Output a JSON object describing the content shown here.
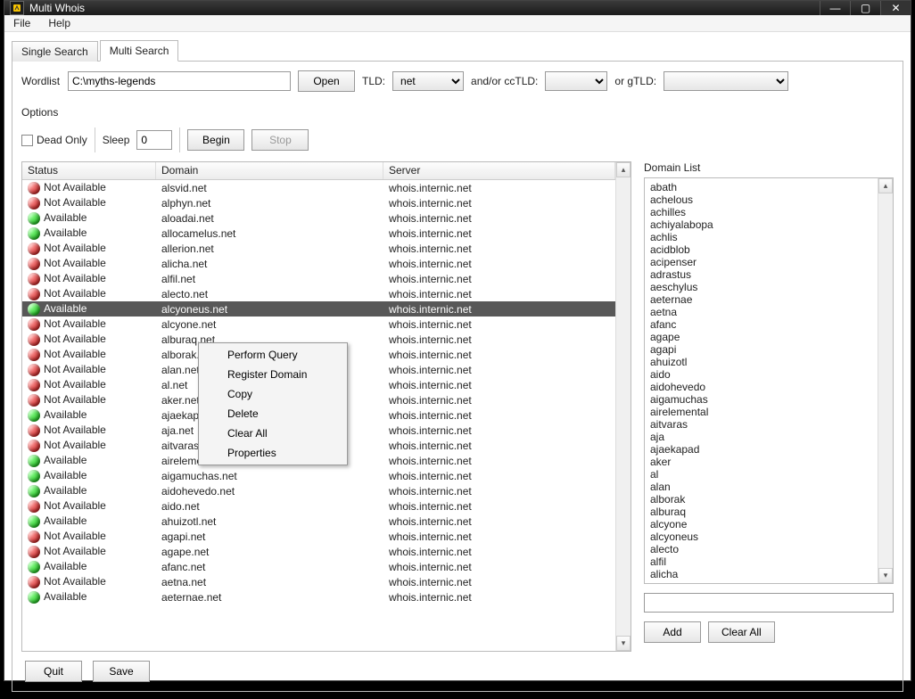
{
  "window": {
    "title": "Multi Whois"
  },
  "menu": {
    "file": "File",
    "help": "Help"
  },
  "tabs": {
    "single": "Single Search",
    "multi": "Multi Search"
  },
  "toolbar": {
    "wordlist_label": "Wordlist",
    "wordlist_value": "C:\\myths-legends",
    "open": "Open",
    "tld_label": "TLD:",
    "tld_value": "net",
    "cctld_label": "and/or ccTLD:",
    "gtld_label": "or gTLD:"
  },
  "options": {
    "heading": "Options",
    "dead_only": "Dead Only",
    "sleep_label": "Sleep",
    "sleep_value": "0",
    "begin": "Begin",
    "stop": "Stop"
  },
  "results": {
    "headers": {
      "status": "Status",
      "domain": "Domain",
      "server": "Server"
    },
    "status_labels": {
      "available": "Available",
      "not_available": "Not Available"
    },
    "selected_index": 8,
    "rows": [
      {
        "avail": false,
        "domain": "alsvid.net",
        "server": "whois.internic.net"
      },
      {
        "avail": false,
        "domain": "alphyn.net",
        "server": "whois.internic.net"
      },
      {
        "avail": true,
        "domain": "aloadai.net",
        "server": "whois.internic.net"
      },
      {
        "avail": true,
        "domain": "allocamelus.net",
        "server": "whois.internic.net"
      },
      {
        "avail": false,
        "domain": "allerion.net",
        "server": "whois.internic.net"
      },
      {
        "avail": false,
        "domain": "alicha.net",
        "server": "whois.internic.net"
      },
      {
        "avail": false,
        "domain": "alfil.net",
        "server": "whois.internic.net"
      },
      {
        "avail": false,
        "domain": "alecto.net",
        "server": "whois.internic.net"
      },
      {
        "avail": true,
        "domain": "alcyoneus.net",
        "server": "whois.internic.net"
      },
      {
        "avail": false,
        "domain": "alcyone.net",
        "server": "whois.internic.net"
      },
      {
        "avail": false,
        "domain": "alburaq.net",
        "server": "whois.internic.net"
      },
      {
        "avail": false,
        "domain": "alborak.net",
        "server": "whois.internic.net"
      },
      {
        "avail": false,
        "domain": "alan.net",
        "server": "whois.internic.net"
      },
      {
        "avail": false,
        "domain": "al.net",
        "server": "whois.internic.net"
      },
      {
        "avail": false,
        "domain": "aker.net",
        "server": "whois.internic.net"
      },
      {
        "avail": true,
        "domain": "ajaekapad.net",
        "server": "whois.internic.net"
      },
      {
        "avail": false,
        "domain": "aja.net",
        "server": "whois.internic.net"
      },
      {
        "avail": false,
        "domain": "aitvaras.net",
        "server": "whois.internic.net"
      },
      {
        "avail": true,
        "domain": "airelemental.net",
        "server": "whois.internic.net"
      },
      {
        "avail": true,
        "domain": "aigamuchas.net",
        "server": "whois.internic.net"
      },
      {
        "avail": true,
        "domain": "aidohevedo.net",
        "server": "whois.internic.net"
      },
      {
        "avail": false,
        "domain": "aido.net",
        "server": "whois.internic.net"
      },
      {
        "avail": true,
        "domain": "ahuizotl.net",
        "server": "whois.internic.net"
      },
      {
        "avail": false,
        "domain": "agapi.net",
        "server": "whois.internic.net"
      },
      {
        "avail": false,
        "domain": "agape.net",
        "server": "whois.internic.net"
      },
      {
        "avail": true,
        "domain": "afanc.net",
        "server": "whois.internic.net"
      },
      {
        "avail": false,
        "domain": "aetna.net",
        "server": "whois.internic.net"
      },
      {
        "avail": true,
        "domain": "aeternae.net",
        "server": "whois.internic.net"
      }
    ]
  },
  "domain_list": {
    "heading": "Domain List",
    "items": [
      "abath",
      "achelous",
      "achilles",
      "achiyalabopa",
      "achlis",
      "acidblob",
      "acipenser",
      "adrastus",
      "aeschylus",
      "aeternae",
      "aetna",
      "afanc",
      "agape",
      "agapi",
      "ahuizotl",
      "aido",
      "aidohevedo",
      "aigamuchas",
      "airelemental",
      "aitvaras",
      "aja",
      "ajaekapad",
      "aker",
      "al",
      "alan",
      "alborak",
      "alburaq",
      "alcyone",
      "alcyoneus",
      "alecto",
      "alfil",
      "alicha"
    ],
    "add": "Add",
    "clearall": "Clear All"
  },
  "context_menu": {
    "items": [
      "Perform Query",
      "Register Domain",
      "Copy",
      "Delete",
      "Clear All",
      "Properties"
    ]
  },
  "footer": {
    "quit": "Quit",
    "save": "Save"
  },
  "winctrl": {
    "min": "—",
    "max": "▢",
    "close": "✕"
  }
}
